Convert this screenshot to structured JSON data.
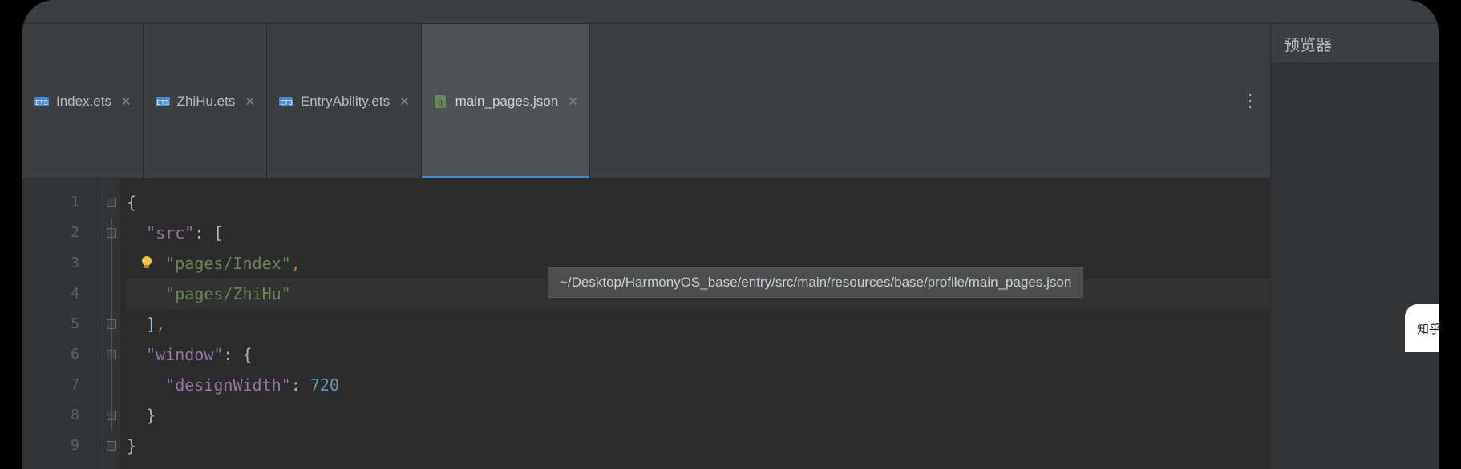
{
  "tabs": [
    {
      "label": "Index.ets",
      "active": false,
      "type": "ets"
    },
    {
      "label": "ZhiHu.ets",
      "active": false,
      "type": "ets"
    },
    {
      "label": "EntryAbility.ets",
      "active": false,
      "type": "ets"
    },
    {
      "label": "main_pages.json",
      "active": true,
      "type": "json"
    }
  ],
  "tooltip_path": "~/Desktop/HarmonyOS_base/entry/src/main/resources/base/profile/main_pages.json",
  "previewer_title": "预览器",
  "preview_chip_text": "知乎",
  "gutter_lines": [
    "1",
    "2",
    "3",
    "4",
    "5",
    "6",
    "7",
    "8",
    "9"
  ],
  "code": {
    "l1_brace": "{",
    "l2_key": "\"src\"",
    "l2_colon": ": [",
    "l3_str": "\"pages/Index\"",
    "l3_comma": ",",
    "l4_str": "\"pages/ZhiHu\"",
    "l5_close": "]",
    "l5_comma": ",",
    "l6_key": "\"window\"",
    "l6_colon": ": {",
    "l7_key": "\"designWidth\"",
    "l7_colon": ": ",
    "l7_num": "720",
    "l8_close": "}",
    "l9_close": "}"
  }
}
